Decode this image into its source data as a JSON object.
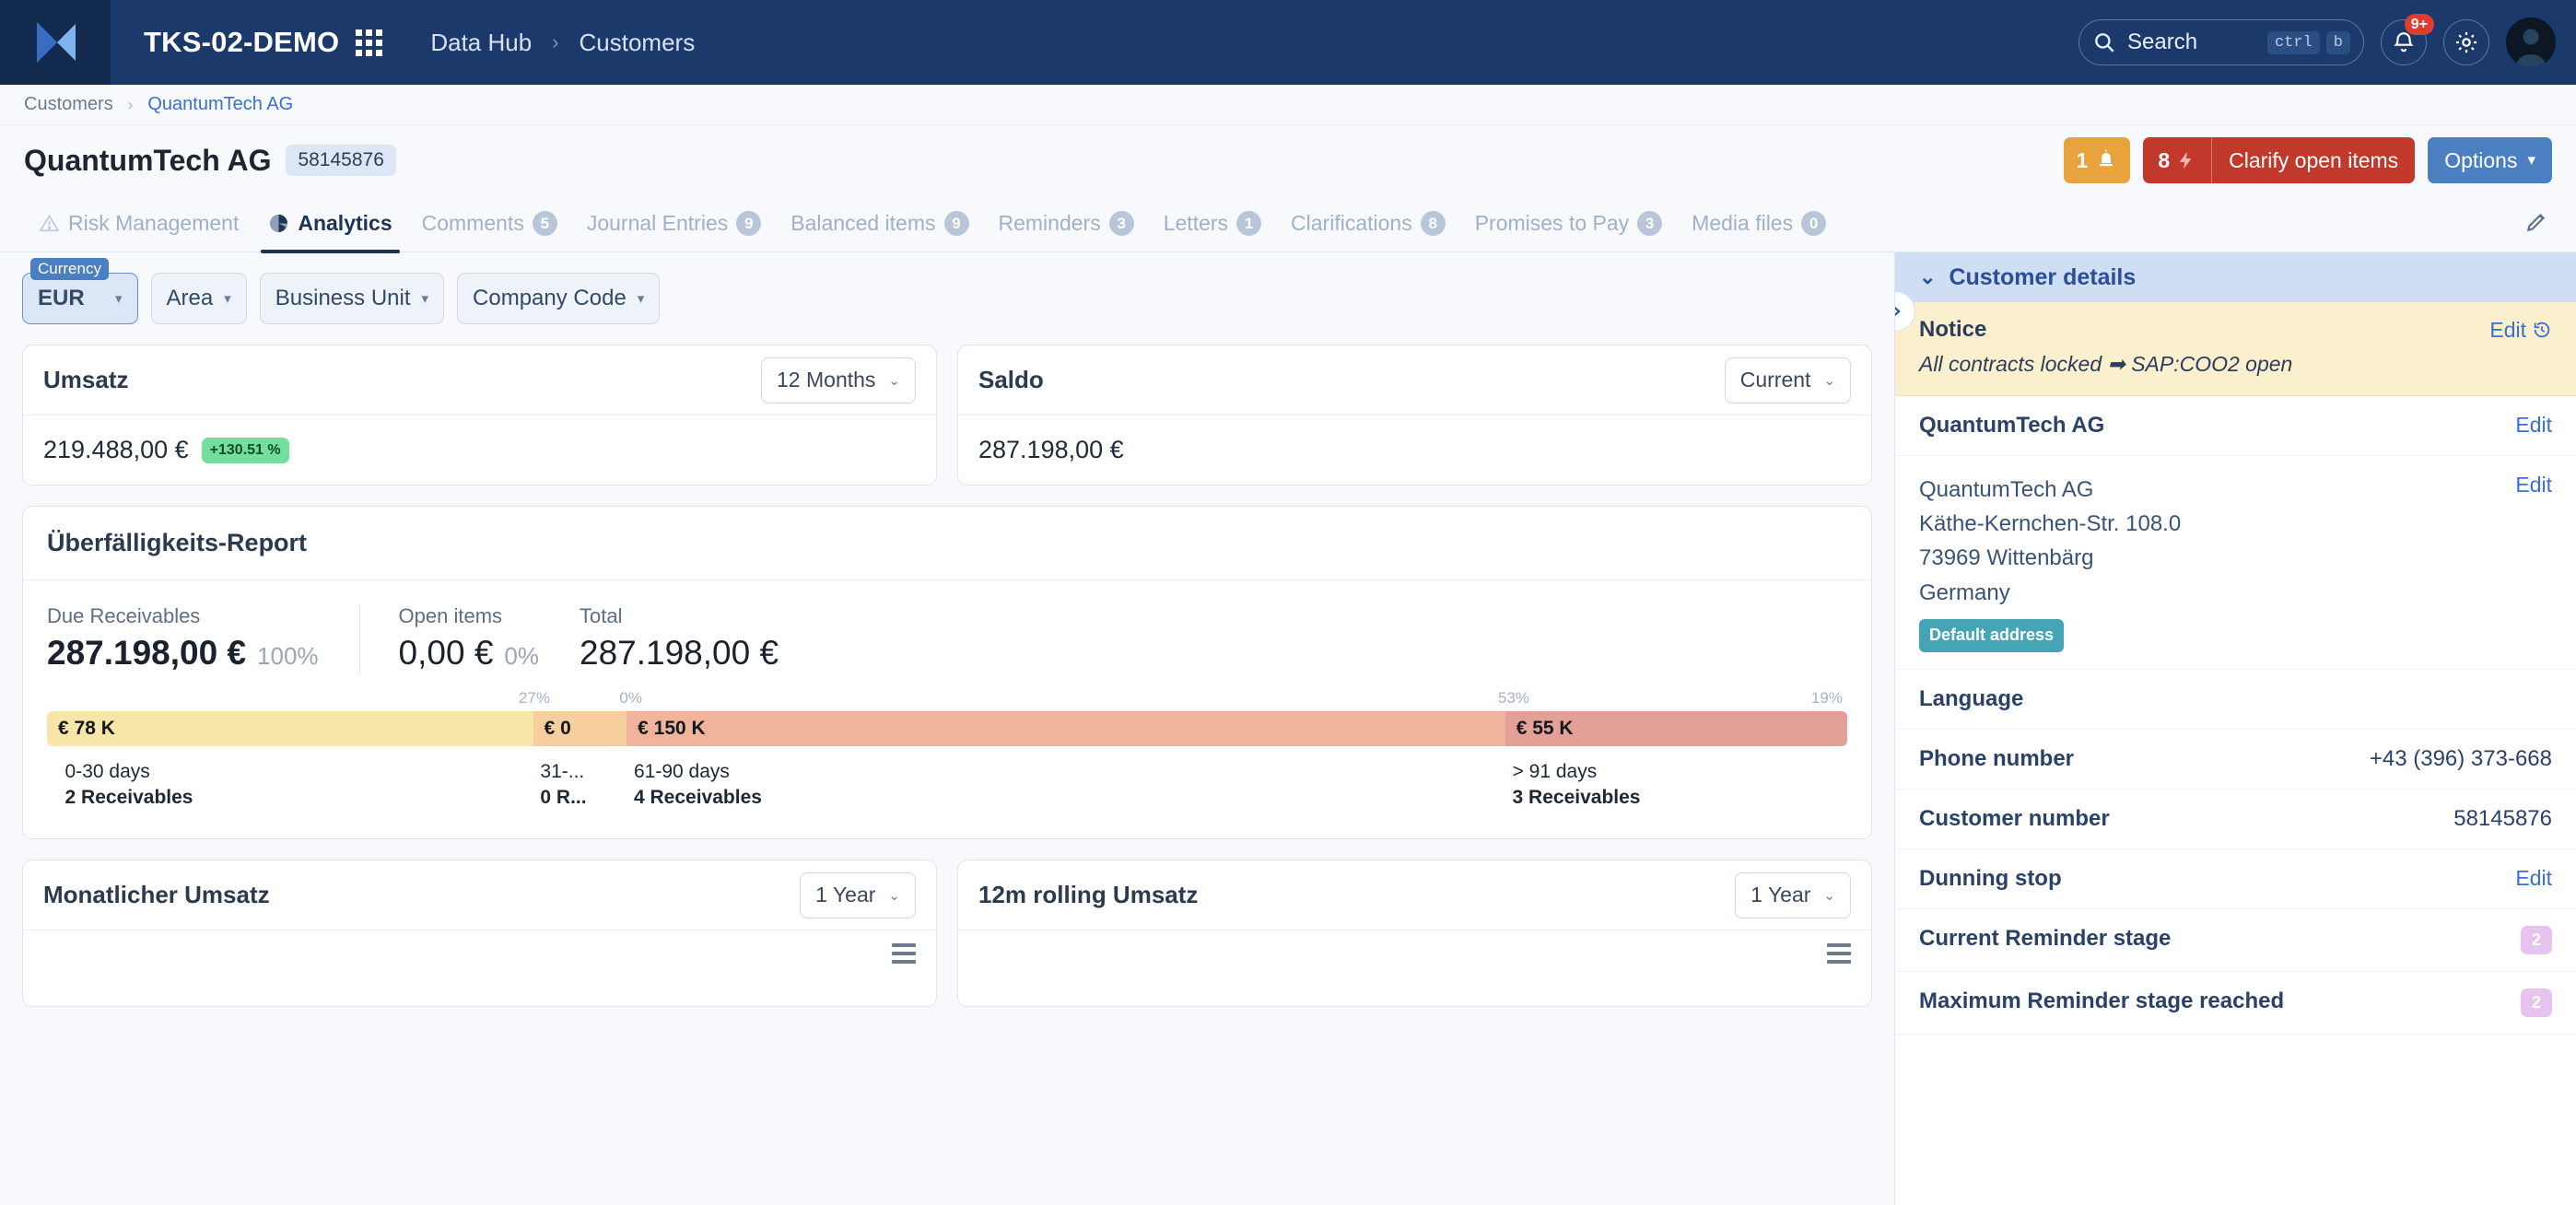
{
  "topnav": {
    "brand": "TKS-02-DEMO",
    "grid_icon": "app-grid-icon",
    "breadcrumbs": [
      {
        "label": "Data Hub"
      },
      {
        "label": "Customers"
      }
    ],
    "separator": "›",
    "search": {
      "placeholder": "Search",
      "label": "Search",
      "keys": [
        "ctrl",
        "b"
      ],
      "icon": "search-icon"
    },
    "notifications": {
      "icon": "bell-icon",
      "badge": "9+"
    },
    "settings": {
      "icon": "gear-icon"
    },
    "avatar": {
      "icon": "user-avatar-icon"
    }
  },
  "breadcrumb_bar": {
    "parent": "Customers",
    "separator": "›",
    "current": "QuantumTech AG"
  },
  "titlebar": {
    "title": "QuantumTech AG",
    "id_chip": "58145876",
    "alarm_button": {
      "count": "1",
      "icon": "alarm-bell-icon"
    },
    "clarify_button": {
      "count": "8",
      "icon": "lightning-icon",
      "label": "Clarify open items"
    },
    "options_button": {
      "label": "Options",
      "caret": "▾"
    }
  },
  "tabs": [
    {
      "label": "Risk Management",
      "count": null,
      "icon": "warning-triangle-icon",
      "active": false
    },
    {
      "label": "Analytics",
      "count": null,
      "icon": "pie-chart-icon",
      "active": true
    },
    {
      "label": "Comments",
      "count": "5",
      "active": false
    },
    {
      "label": "Journal Entries",
      "count": "9",
      "active": false
    },
    {
      "label": "Balanced items",
      "count": "9",
      "active": false
    },
    {
      "label": "Reminders",
      "count": "3",
      "active": false
    },
    {
      "label": "Letters",
      "count": "1",
      "active": false
    },
    {
      "label": "Clarifications",
      "count": "8",
      "active": false
    },
    {
      "label": "Promises to Pay",
      "count": "3",
      "active": false
    },
    {
      "label": "Media files",
      "count": "0",
      "active": false
    }
  ],
  "tabs_edit_icon": "pencil-icon",
  "filters": {
    "currency": {
      "tag": "Currency",
      "value": "EUR",
      "caret": "▾"
    },
    "area": {
      "label": "Area",
      "caret": "▾"
    },
    "business_unit": {
      "label": "Business Unit",
      "caret": "▾"
    },
    "company_code": {
      "label": "Company Code",
      "caret": "▾"
    }
  },
  "umsatz_card": {
    "title": "Umsatz",
    "range": "12 Months",
    "caret": "⌄",
    "value": "219.488,00 €",
    "delta": "+130.51 %"
  },
  "saldo_card": {
    "title": "Saldo",
    "range": "Current",
    "caret": "⌄",
    "value": "287.198,00 €"
  },
  "aging_report": {
    "title": "Überfälligkeits-Report",
    "stats": [
      {
        "label": "Due Receivables",
        "value": "287.198,00 €",
        "pct": "100%"
      },
      {
        "label": "Open items",
        "value": "0,00 €",
        "pct": "0%"
      },
      {
        "label": "Total",
        "value": "287.198,00 €",
        "pct": ""
      }
    ]
  },
  "chart_data": {
    "type": "bar",
    "title": "Überfälligkeits-Report",
    "orientation": "horizontal-stacked",
    "categories": [
      "0-30 days",
      "31-...",
      "61-90 days",
      "> 91 days"
    ],
    "values": [
      78000,
      0,
      150000,
      55000
    ],
    "value_labels": [
      "€ 78 K",
      "€ 0",
      "€ 150 K",
      "€ 55 K"
    ],
    "percent_labels": [
      "27%",
      "0%",
      "53%",
      "19%"
    ],
    "width_percent": [
      27,
      5,
      53,
      19
    ],
    "counts": [
      "2 Receivables",
      "0 R...",
      "4 Receivables",
      "3 Receivables"
    ],
    "colors": [
      "#f8e6a8",
      "#f7cf9e",
      "#efb49b",
      "#e3a096"
    ],
    "total": "287.198,00 €",
    "legend": "none",
    "grid": false
  },
  "monthly_chart": {
    "title": "Monatlicher Umsatz",
    "range": "1 Year",
    "caret": "⌄",
    "menu_icon": "hamburger-menu-icon"
  },
  "rolling_chart": {
    "title": "12m rolling Umsatz",
    "range": "1 Year",
    "caret": "⌄",
    "menu_icon": "hamburger-menu-icon"
  },
  "sidebar": {
    "header": "Customer details",
    "chevron": "⌄",
    "collapse_icon": "chevron-right-icon",
    "notice": {
      "title": "Notice",
      "edit": "Edit",
      "history_icon": "history-icon",
      "warning_icon": "⚠",
      "text": "All contracts locked ➡ SAP:COO2 open"
    },
    "company_row": {
      "name": "QuantumTech AG",
      "edit": "Edit"
    },
    "address": {
      "lines": [
        "QuantumTech AG",
        "Käthe-Kernchen-Str. 108.0",
        "73969 Wittenbärg",
        "Germany"
      ],
      "tag": "Default address",
      "edit": "Edit"
    },
    "rows": [
      {
        "key": "Language",
        "value": "",
        "type": "plain"
      },
      {
        "key": "Phone number",
        "value": "+43 (396) 373-668",
        "type": "plain"
      },
      {
        "key": "Customer number",
        "value": "58145876",
        "type": "plain"
      },
      {
        "key": "Dunning stop",
        "value": "Edit",
        "type": "edit"
      },
      {
        "key": "Current Reminder stage",
        "value": "2",
        "type": "pill"
      },
      {
        "key": "Maximum Reminder stage reached",
        "value": "2",
        "type": "pill"
      }
    ]
  }
}
